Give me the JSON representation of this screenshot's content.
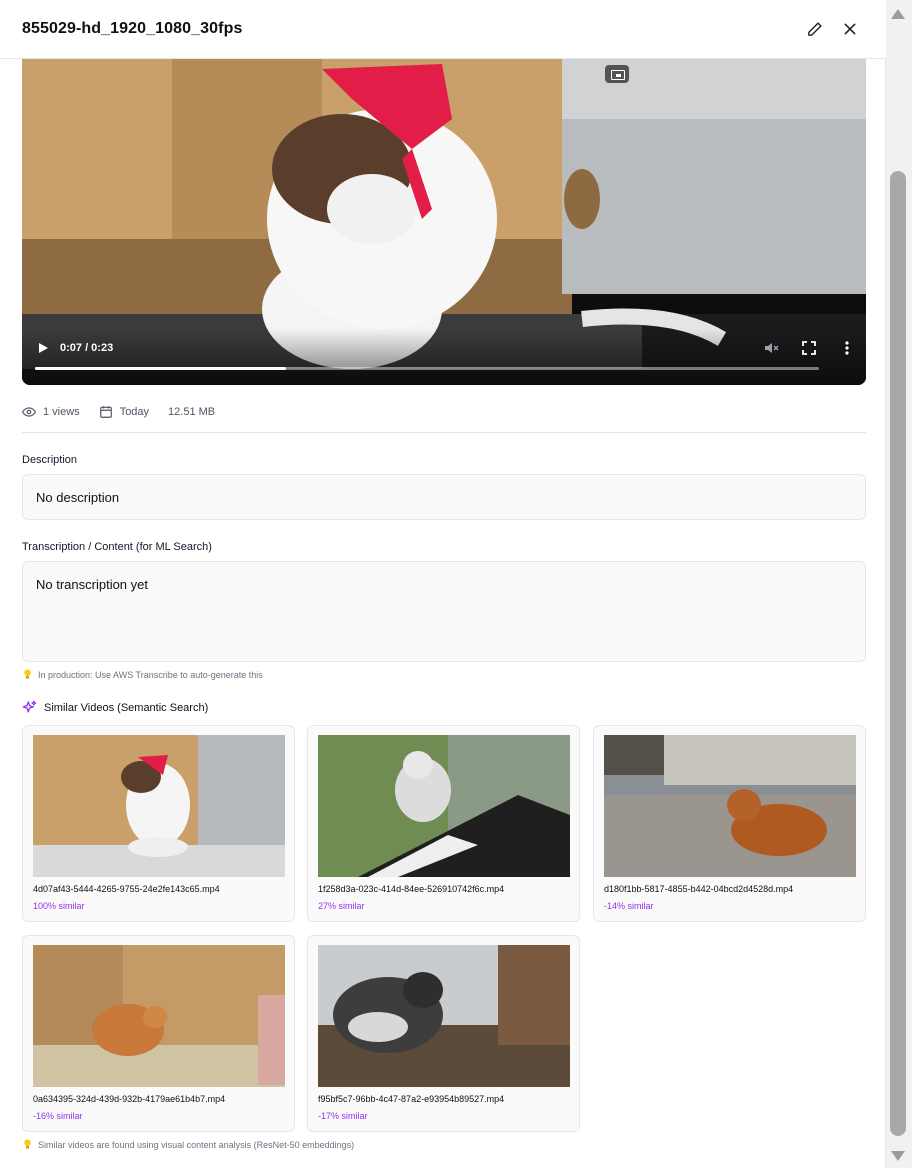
{
  "header": {
    "title": "855029-hd_1920_1080_30fps",
    "edit_icon": "pencil-icon",
    "close_icon": "close-icon"
  },
  "player": {
    "time": "0:07 / 0:23",
    "progress_fraction": 0.32,
    "icons": [
      "play-icon",
      "volume-muted-icon",
      "fullscreen-icon",
      "more-vertical-icon",
      "picture-in-picture-icon"
    ]
  },
  "meta": {
    "views": "1 views",
    "date": "Today",
    "size": "12.51 MB"
  },
  "description": {
    "label": "Description",
    "value": "No description"
  },
  "transcription": {
    "label": "Transcription / Content (for ML Search)",
    "value": "No transcription yet",
    "hint": "In production: Use AWS Transcribe to auto-generate this"
  },
  "similar": {
    "title": "Similar Videos (Semantic Search)",
    "items": [
      {
        "file": "4d07af43-5444-4265-9755-24e2fe143c65.mp4",
        "similarity": "100% similar"
      },
      {
        "file": "1f258d3a-023c-414d-84ee-526910742f6c.mp4",
        "similarity": "27% similar"
      },
      {
        "file": "d180f1bb-5817-4855-b442-04bcd2d4528d.mp4",
        "similarity": "-14% similar"
      },
      {
        "file": "0a634395-324d-439d-932b-4179ae61b4b7.mp4",
        "similarity": "-16% similar"
      },
      {
        "file": "f95bf5c7-96bb-4c47-87a2-e93954b89527.mp4",
        "similarity": "-17% similar"
      }
    ],
    "footer_hint": "Similar videos are found using visual content analysis (ResNet-50 embeddings)"
  },
  "colors": {
    "accent_purple": "#9333ea",
    "border": "#e5e7eb",
    "field_bg": "#f8f9fa"
  }
}
